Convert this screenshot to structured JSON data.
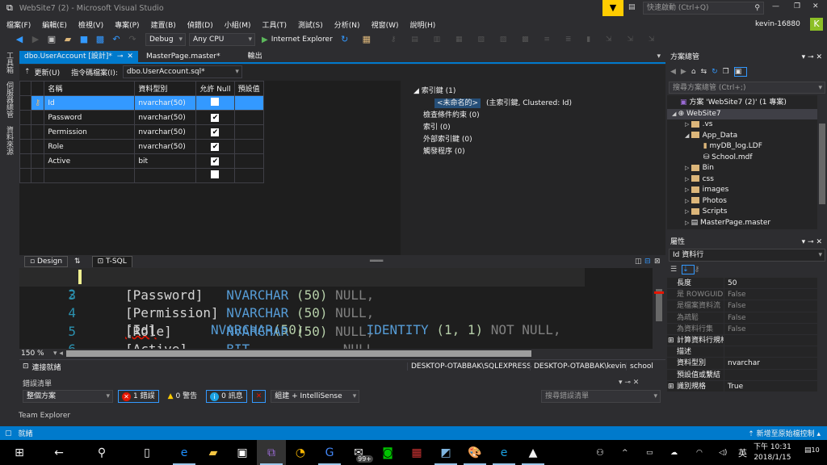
{
  "window": {
    "title": "WebSite7 (2) - Microsoft Visual Studio",
    "quick_launch_placeholder": "快速啟動 (Ctrl+Q)",
    "user": "kevin-16880",
    "avatar_letter": "K"
  },
  "menu": [
    "檔案(F)",
    "編輯(E)",
    "檢視(V)",
    "專案(P)",
    "建置(B)",
    "偵錯(D)",
    "小組(M)",
    "工具(T)",
    "測試(S)",
    "分析(N)",
    "視窗(W)",
    "說明(H)"
  ],
  "toolbar": {
    "config": "Debug",
    "platform": "Any CPU",
    "run_target": "Internet Explorer"
  },
  "left_strip": [
    "工具箱",
    "伺服器總管",
    "資料來源"
  ],
  "doc_tabs": [
    {
      "label": "dbo.UserAccount [設計]*",
      "active": true
    },
    {
      "label": "MasterPage.master*"
    },
    {
      "label": "輸出"
    }
  ],
  "designer": {
    "update_label": "更新(U)",
    "script_label": "指令碼檔案(I):",
    "script_file": "dbo.UserAccount.sql*",
    "headers": [
      "名稱",
      "資料型別",
      "允許 Null",
      "預設值"
    ],
    "rows": [
      {
        "name": "Id",
        "type": "nvarchar(50)",
        "null": false,
        "key": true
      },
      {
        "name": "Password",
        "type": "nvarchar(50)",
        "null": true
      },
      {
        "name": "Permission",
        "type": "nvarchar(50)",
        "null": true
      },
      {
        "name": "Role",
        "type": "nvarchar(50)",
        "null": true
      },
      {
        "name": "Active",
        "type": "bit",
        "null": true
      },
      {
        "name": "",
        "type": "",
        "null": false
      }
    ],
    "keys": {
      "primary": "索引鍵 (1)",
      "unnamed": "<未命名的>",
      "unnamed_desc": "(主索引鍵, Clustered: Id)",
      "check": "檢查條件約束 (0)",
      "index": "索引 (0)",
      "foreign": "外部索引鍵 (0)",
      "trigger": "觸發程序 (0)"
    }
  },
  "pane_tabs": {
    "design": "Design",
    "swap": "⇅",
    "tsql": "T-SQL"
  },
  "code": {
    "lines": [
      {
        "n": "2",
        "name": "[Id]",
        "type": "NVARCHAR",
        "args": "(50)",
        "rest": "IDENTITY",
        "rest2": "(1, 1)",
        "tail": "NOT NULL,"
      },
      {
        "n": "3",
        "name": "[Password]",
        "type": "NVARCHAR",
        "args": " (50)",
        "tail": "NULL,"
      },
      {
        "n": "4",
        "name": "[Permission]",
        "type": "NVARCHAR",
        "args": " (50)",
        "tail": "NULL,"
      },
      {
        "n": "5",
        "name": "[Role]",
        "type": "NVARCHAR",
        "args": " (50)",
        "tail": "NULL,"
      },
      {
        "n": "6",
        "name": "[Active]",
        "type": "BIT",
        "args": "",
        "tail": "NULL,"
      }
    ],
    "zoom": "150 %"
  },
  "connection": {
    "status": "連接就緒",
    "server": "DESKTOP-OTABBAK\\SQLEXPRESS",
    "user": "DESKTOP-OTABBAK\\kevin",
    "db": "school"
  },
  "error_list": {
    "title": "錯誤清單",
    "scope": "整個方案",
    "errors": "1 錯誤",
    "warnings": "0 警告",
    "messages": "0 訊息",
    "source": "組建 + IntelliSense",
    "search_placeholder": "搜尋錯誤清單"
  },
  "team_explorer": "Team Explorer",
  "status": {
    "left": "就緒",
    "right": "新增至原始檔控制"
  },
  "solution_explorer": {
    "title": "方案總管",
    "search_placeholder": "搜尋方案總管 (Ctrl+;)",
    "items": [
      {
        "label": "方案 'WebSite7 (2)' (1 專案)",
        "depth": 0,
        "kind": "solution"
      },
      {
        "label": "WebSite7",
        "depth": 0,
        "kind": "web",
        "open": true
      },
      {
        "label": ".vs",
        "depth": 1,
        "kind": "folder"
      },
      {
        "label": "App_Data",
        "depth": 1,
        "kind": "folder",
        "open": true
      },
      {
        "label": "myDB_log.LDF",
        "depth": 2,
        "kind": "file"
      },
      {
        "label": "School.mdf",
        "depth": 2,
        "kind": "db"
      },
      {
        "label": "Bin",
        "depth": 1,
        "kind": "folder"
      },
      {
        "label": "css",
        "depth": 1,
        "kind": "folder"
      },
      {
        "label": "images",
        "depth": 1,
        "kind": "folder"
      },
      {
        "label": "Photos",
        "depth": 1,
        "kind": "folder"
      },
      {
        "label": "Scripts",
        "depth": 1,
        "kind": "folder"
      },
      {
        "label": "MasterPage.master",
        "depth": 1,
        "kind": "page"
      }
    ]
  },
  "properties": {
    "title": "屬性",
    "object": "Id 資料行",
    "rows": [
      {
        "k": "長度",
        "v": "50"
      },
      {
        "k": "是 ROWGUID 資",
        "v": "False",
        "dim": true
      },
      {
        "k": "是檔案資料流",
        "v": "False",
        "dim": true
      },
      {
        "k": "為疏鬆",
        "v": "False",
        "dim": true
      },
      {
        "k": "為資料行集",
        "v": "False",
        "dim": true
      },
      {
        "k": "計算資料行規格",
        "v": "",
        "exp": true
      },
      {
        "k": "描述",
        "v": ""
      },
      {
        "k": "資料型別",
        "v": "nvarchar"
      },
      {
        "k": "預設值或繫結",
        "v": ""
      },
      {
        "k": "識別規格",
        "v": "True",
        "exp": true
      }
    ]
  },
  "taskbar": {
    "time": "下午 10:31",
    "date": "2018/1/15",
    "ime": "英",
    "mail_badge": "99+",
    "notif_count": "10"
  },
  "colors": {
    "accent": "#007acc",
    "selection": "#3399ff",
    "background": "#2d2d30",
    "editor": "#1e1e1e"
  }
}
